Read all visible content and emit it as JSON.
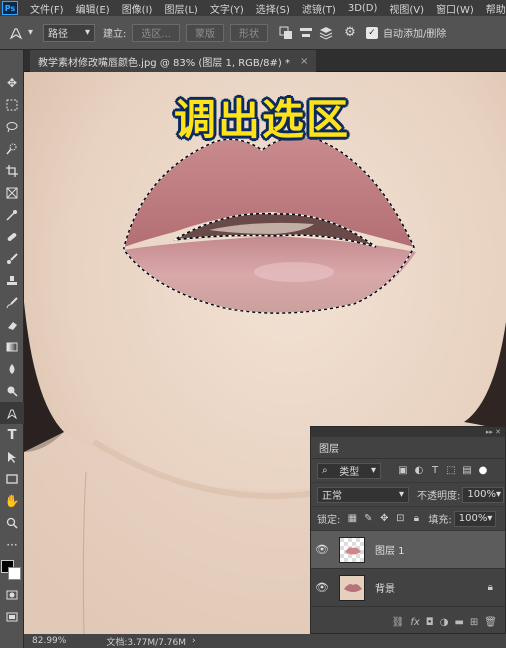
{
  "menubar": {
    "logo": "Ps",
    "items": [
      "文件(F)",
      "编辑(E)",
      "图像(I)",
      "图层(L)",
      "文字(Y)",
      "选择(S)",
      "滤镜(T)",
      "3D(D)",
      "视图(V)",
      "窗口(W)",
      "帮助"
    ]
  },
  "options": {
    "mode_select": "路径",
    "build_label": "建立:",
    "btn_selection": "选区...",
    "btn_mask": "蒙版",
    "btn_shape": "形状",
    "auto_add_delete": "自动添加/删除",
    "auto_add_checked": true
  },
  "tab": {
    "title": "教学素材修改嘴唇颜色.jpg @ 83% (图层 1, RGB/8#) *",
    "close": "×"
  },
  "canvas": {
    "caption": "调出选区"
  },
  "status": {
    "zoom": "82.99%",
    "doc": "文档:3.77M/7.76M"
  },
  "layers_panel": {
    "title": "图层",
    "filter_label": "类型",
    "blend_mode": "正常",
    "opacity_label": "不透明度:",
    "opacity_value": "100%",
    "lock_label": "锁定:",
    "fill_label": "填充:",
    "fill_value": "100%",
    "layers": [
      {
        "name": "图层 1",
        "selected": true,
        "locked": false
      },
      {
        "name": "背景",
        "selected": false,
        "locked": true
      }
    ]
  },
  "colors": {
    "accent": "#31a8ff",
    "caption_fill": "#ffe21a",
    "caption_stroke": "#0b2b5e"
  }
}
